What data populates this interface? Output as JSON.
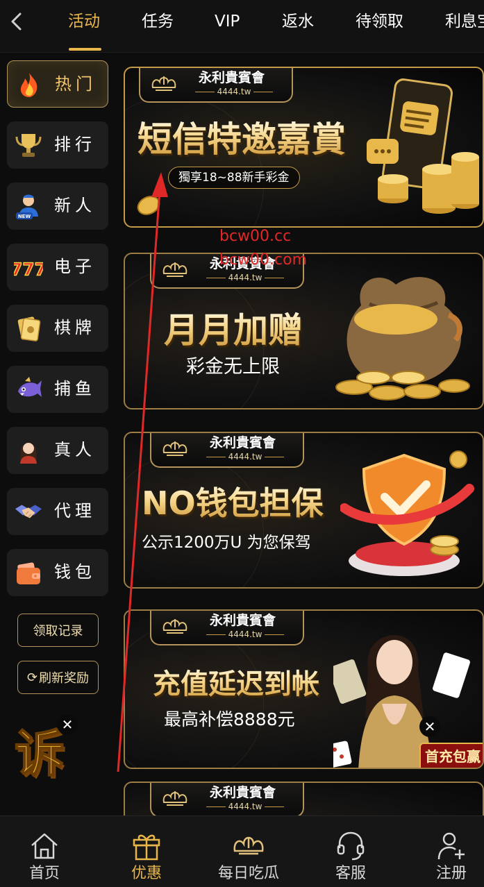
{
  "top_nav": {
    "tabs": [
      "活动",
      "任务",
      "VIP",
      "返水",
      "待领取",
      "利息宝"
    ],
    "active_tab": "活动"
  },
  "sidebar": {
    "items": [
      {
        "label": "热门",
        "icon": "fire-icon",
        "active": true
      },
      {
        "label": "排行",
        "icon": "trophy-icon"
      },
      {
        "label": "新人",
        "icon": "new-user-icon"
      },
      {
        "label": "电子",
        "icon": "slot-777-icon"
      },
      {
        "label": "棋牌",
        "icon": "cards-icon"
      },
      {
        "label": "捕鱼",
        "icon": "fish-icon"
      },
      {
        "label": "真人",
        "icon": "live-dealer-icon"
      },
      {
        "label": "代理",
        "icon": "handshake-icon"
      },
      {
        "label": "钱包",
        "icon": "wallet-icon"
      }
    ],
    "claim_record_label": "领取记录",
    "refresh_reward_label": "刷新奖励",
    "complain_label": "诉"
  },
  "banners": [
    {
      "brand": "永利貴賓會",
      "brand_url": "4444.tw",
      "headline": "短信特邀嘉賞",
      "subline": "獨享18~88新手彩金"
    },
    {
      "brand": "永利貴賓會",
      "brand_url": "4444.tw",
      "headline": "月月加赠",
      "subline": "彩金无上限"
    },
    {
      "brand": "永利貴賓會",
      "brand_url": "4444.tw",
      "headline": "NO钱包担保",
      "subline": "公示1200万U 为您保驾"
    },
    {
      "brand": "永利貴賓會",
      "brand_url": "4444.tw",
      "headline": "充值延迟到帐",
      "subline": "最高补偿8888元",
      "corner_tag": "首充包赢"
    },
    {
      "brand": "永利貴賓會",
      "brand_url": "4444.tw"
    }
  ],
  "watermarks": [
    "bcw00.cc",
    "bcw00.com"
  ],
  "bottom_nav": [
    {
      "label": "首页",
      "icon": "home-icon"
    },
    {
      "label": "优惠",
      "icon": "gift-icon",
      "active": true
    },
    {
      "label": "每日吃瓜",
      "icon": "crown-logo-icon"
    },
    {
      "label": "客服",
      "icon": "headset-icon"
    },
    {
      "label": "注册",
      "icon": "add-user-icon"
    }
  ],
  "colors": {
    "accent": "#e9b64a",
    "background": "#0d0d0d",
    "panel": "#1e1e1e",
    "gold_border": "#b4945a",
    "annotation_red": "#e02828"
  }
}
